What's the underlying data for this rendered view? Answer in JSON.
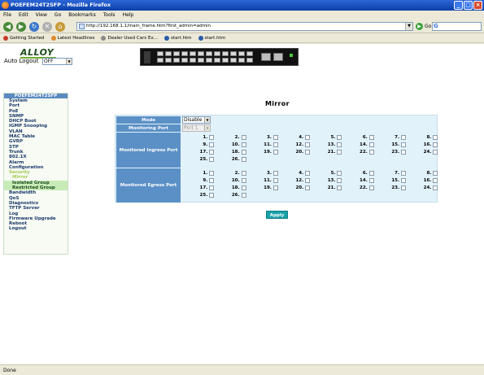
{
  "window": {
    "title": "POEFEM24T2SFP - Mozilla Firefox"
  },
  "menu": [
    "File",
    "Edit",
    "View",
    "Go",
    "Bookmarks",
    "Tools",
    "Help"
  ],
  "nav": {
    "url": "http://192.168.1.1/main_frame.htm?first_admin=admin",
    "go_label": "Go",
    "search_placeholder": "G"
  },
  "bookmarks": [
    "Getting Started",
    "Latest Headlines",
    "Dealer Used Cars Ex...",
    "start.htm",
    "start.htm"
  ],
  "header": {
    "logo": "ALLOY",
    "auto_logout_label": "Auto Logout",
    "auto_logout_value": "OFF"
  },
  "sidebar": {
    "heading": "POEFEM24T2SFP",
    "items": [
      "System",
      "Port",
      "PoE",
      "SNMP",
      "DHCP Boot",
      "IGMP Snooping",
      "VLAN",
      "MAC Table",
      "GVRP",
      "STP",
      "Trunk",
      "802.1X",
      "Alarm",
      "Configuration",
      "Security",
      "Mirror",
      "Isolated Group",
      "Restricted Group",
      "Bandwidth",
      "QoS",
      "Diagnostics",
      "TFTP Server",
      "Log",
      "Firmware Upgrade",
      "Reboot",
      "Logout"
    ]
  },
  "main": {
    "title": "Mirror",
    "mode_label": "Mode",
    "mode_value": "Disable",
    "monitoring_port_label": "Monitoring Port",
    "monitoring_port_value": "Port 1",
    "ingress_label": "Monitored Ingress Port",
    "egress_label": "Monitored Egress Port",
    "ports": [
      "1.",
      "2.",
      "3.",
      "4.",
      "5.",
      "6.",
      "7.",
      "8.",
      "9.",
      "10.",
      "11.",
      "12.",
      "13.",
      "14.",
      "15.",
      "16.",
      "17.",
      "18.",
      "19.",
      "20.",
      "21.",
      "22.",
      "23.",
      "24.",
      "25.",
      "26."
    ],
    "apply_label": "Apply"
  },
  "status": {
    "text": "Done"
  },
  "colors": {
    "label_bg": "#5b90c6",
    "table_bg": "#e2f2fb",
    "apply_bg": "#1aa0a8",
    "sidebar_heading": "#5a8ac0"
  }
}
